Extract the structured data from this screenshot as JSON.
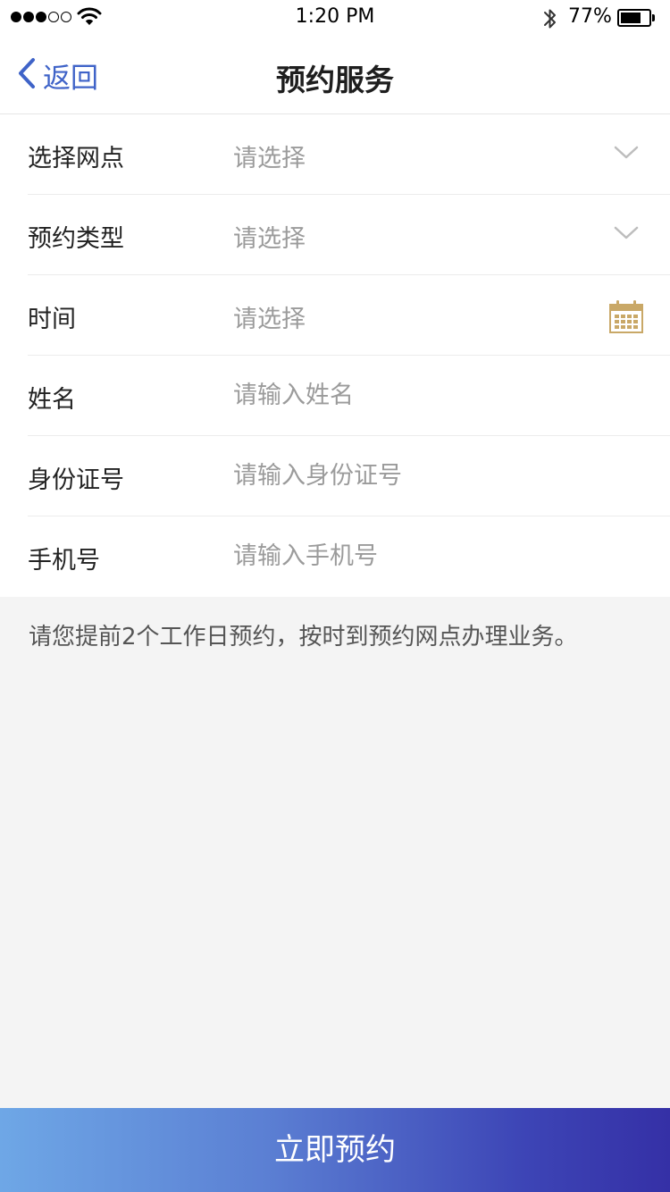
{
  "status_bar": {
    "time": "1:20 PM",
    "battery_percent": "77%",
    "signal_bars_filled": 3,
    "signal_bars_total": 5,
    "battery_level": 0.77
  },
  "nav": {
    "back_label": "返回",
    "title": "预约服务"
  },
  "form": {
    "rows": [
      {
        "label": "选择网点",
        "value": "请选择",
        "icon": "chevron-down-icon"
      },
      {
        "label": "预约类型",
        "value": "请选择",
        "icon": "chevron-down-icon"
      },
      {
        "label": "时间",
        "value": "请选择",
        "icon": "calendar-icon"
      },
      {
        "label": "姓名",
        "placeholder": "请输入姓名"
      },
      {
        "label": "身份证号",
        "placeholder": "请输入身份证号"
      },
      {
        "label": "手机号",
        "placeholder": "请输入手机号"
      }
    ]
  },
  "note": "请您提前2个工作日预约，按时到预约网点办理业务。",
  "submit_label": "立即预约",
  "colors": {
    "accent_blue": "#3f63c8",
    "calendar_gold": "#c9a867",
    "placeholder_gray": "#9b9b9b",
    "page_background": "#f4f4f4",
    "button_gradient_start": "#6ea7e6",
    "button_gradient_end": "#3530a6"
  }
}
